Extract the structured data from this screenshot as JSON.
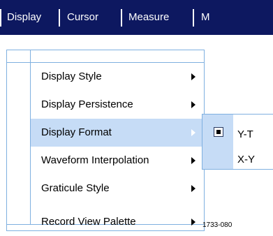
{
  "menubar": {
    "items": [
      {
        "label": "Display"
      },
      {
        "label": "Cursor"
      },
      {
        "label": "Measure"
      },
      {
        "label": "M"
      }
    ]
  },
  "display_menu": {
    "items": [
      {
        "label": "Display Style",
        "has_submenu": true
      },
      {
        "label": "Display Persistence",
        "has_submenu": true
      },
      {
        "label": "Display Format",
        "has_submenu": true,
        "active": true
      },
      {
        "label": "Waveform Interpolation",
        "has_submenu": true
      },
      {
        "label": "Graticule Style",
        "has_submenu": true
      },
      {
        "label": "Record View Palette",
        "has_submenu": true
      }
    ]
  },
  "format_submenu": {
    "options": [
      {
        "label": "Y-T",
        "selected": true
      },
      {
        "label": "X-Y",
        "selected": false
      }
    ]
  },
  "figure_id": "1733-080",
  "colors": {
    "menubar_bg": "#0d1860",
    "highlight": "#c6dcf6",
    "border": "#7fb0e0"
  },
  "icons": {
    "submenu_arrow": "triangle-right-icon",
    "radio_selected": "filled-square-icon"
  }
}
